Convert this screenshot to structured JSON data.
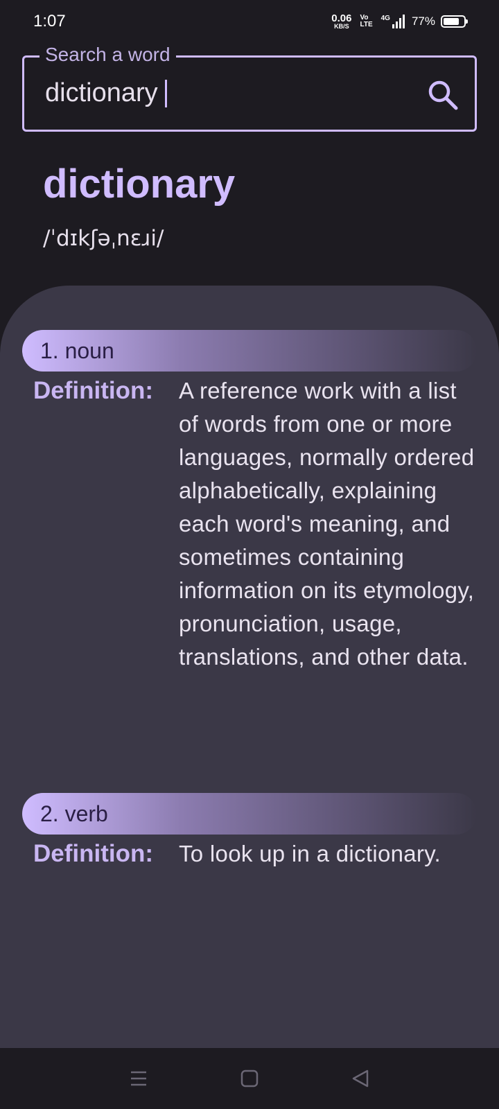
{
  "status": {
    "time": "1:07",
    "speed_value": "0.06",
    "speed_unit": "KB/S",
    "volte_top": "Vo",
    "volte_bottom": "LTE",
    "network": "4G",
    "battery": "77%",
    "battery_level": 0.77
  },
  "search": {
    "label": "Search a word",
    "value": "dictionary"
  },
  "word": {
    "title": "dictionary",
    "phonetic": "/ˈdɪkʃəˌnɛɹi/"
  },
  "meanings": [
    {
      "header": "1. noun",
      "definition_label": "Definition:",
      "definition": "A reference work with a list of words from one or more languages, normally ordered alphabetically, explaining each word's meaning, and sometimes containing information on its etymology, pronunciation, usage, translations, and other data."
    },
    {
      "header": "2. verb",
      "definition_label": "Definition:",
      "definition": "To look up in a dictionary."
    }
  ],
  "colors": {
    "accent": "#d0bcff",
    "background": "#1d1b21",
    "card": "#3b3847"
  },
  "icons": {
    "search": "search-icon",
    "menu": "menu-icon",
    "home": "home-icon",
    "back": "back-icon"
  }
}
